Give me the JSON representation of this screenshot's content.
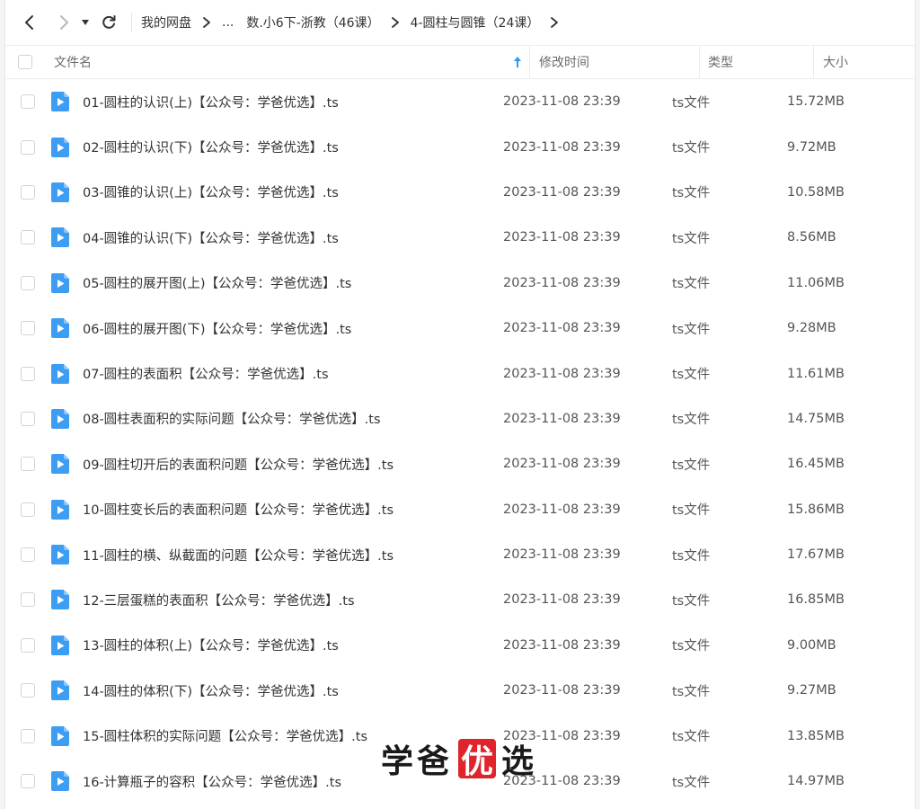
{
  "breadcrumb": {
    "items": [
      {
        "label": "我的网盘"
      },
      {
        "label": "..."
      },
      {
        "label": "数.小6下-浙教（46课）"
      },
      {
        "label": "4-圆柱与圆锥（24课）"
      }
    ]
  },
  "table": {
    "headers": {
      "name": "文件名",
      "time": "修改时间",
      "type": "类型",
      "size": "大小"
    },
    "rows": [
      {
        "name": "01-圆柱的认识(上)【公众号：学爸优选】.ts",
        "time": "2023-11-08 23:39",
        "type": "ts文件",
        "size": "15.72MB"
      },
      {
        "name": "02-圆柱的认识(下)【公众号：学爸优选】.ts",
        "time": "2023-11-08 23:39",
        "type": "ts文件",
        "size": "9.72MB"
      },
      {
        "name": "03-圆锥的认识(上)【公众号：学爸优选】.ts",
        "time": "2023-11-08 23:39",
        "type": "ts文件",
        "size": "10.58MB"
      },
      {
        "name": "04-圆锥的认识(下)【公众号：学爸优选】.ts",
        "time": "2023-11-08 23:39",
        "type": "ts文件",
        "size": "8.56MB"
      },
      {
        "name": "05-圆柱的展开图(上)【公众号：学爸优选】.ts",
        "time": "2023-11-08 23:39",
        "type": "ts文件",
        "size": "11.06MB"
      },
      {
        "name": "06-圆柱的展开图(下)【公众号：学爸优选】.ts",
        "time": "2023-11-08 23:39",
        "type": "ts文件",
        "size": "9.28MB"
      },
      {
        "name": "07-圆柱的表面积【公众号：学爸优选】.ts",
        "time": "2023-11-08 23:39",
        "type": "ts文件",
        "size": "11.61MB"
      },
      {
        "name": "08-圆柱表面积的实际问题【公众号：学爸优选】.ts",
        "time": "2023-11-08 23:39",
        "type": "ts文件",
        "size": "14.75MB"
      },
      {
        "name": "09-圆柱切开后的表面积问题【公众号：学爸优选】.ts",
        "time": "2023-11-08 23:39",
        "type": "ts文件",
        "size": "16.45MB"
      },
      {
        "name": "10-圆柱变长后的表面积问题【公众号：学爸优选】.ts",
        "time": "2023-11-08 23:39",
        "type": "ts文件",
        "size": "15.86MB"
      },
      {
        "name": "11-圆柱的横、纵截面的问题【公众号：学爸优选】.ts",
        "time": "2023-11-08 23:39",
        "type": "ts文件",
        "size": "17.67MB"
      },
      {
        "name": "12-三层蛋糕的表面积【公众号：学爸优选】.ts",
        "time": "2023-11-08 23:39",
        "type": "ts文件",
        "size": "16.85MB"
      },
      {
        "name": "13-圆柱的体积(上)【公众号：学爸优选】.ts",
        "time": "2023-11-08 23:39",
        "type": "ts文件",
        "size": "9.00MB"
      },
      {
        "name": "14-圆柱的体积(下)【公众号：学爸优选】.ts",
        "time": "2023-11-08 23:39",
        "type": "ts文件",
        "size": "9.27MB"
      },
      {
        "name": "15-圆柱体积的实际问题【公众号：学爸优选】.ts",
        "time": "2023-11-08 23:39",
        "type": "ts文件",
        "size": "13.85MB"
      },
      {
        "name": "16-计算瓶子的容积【公众号：学爸优选】.ts",
        "time": "2023-11-08 23:39",
        "type": "ts文件",
        "size": "14.97MB"
      }
    ]
  },
  "watermark": {
    "part1": "学爸",
    "part2": "优",
    "part3": "选"
  },
  "colors": {
    "accent": "#2f94f5",
    "file_icon": "#3d9df3",
    "watermark_red": "#e0242b"
  },
  "icons": {
    "back": "chevron-left-icon",
    "forward": "chevron-right-icon",
    "dropdown": "caret-down-icon",
    "refresh": "refresh-icon",
    "sort": "sort-ascending-icon",
    "file": "video-file-icon"
  }
}
